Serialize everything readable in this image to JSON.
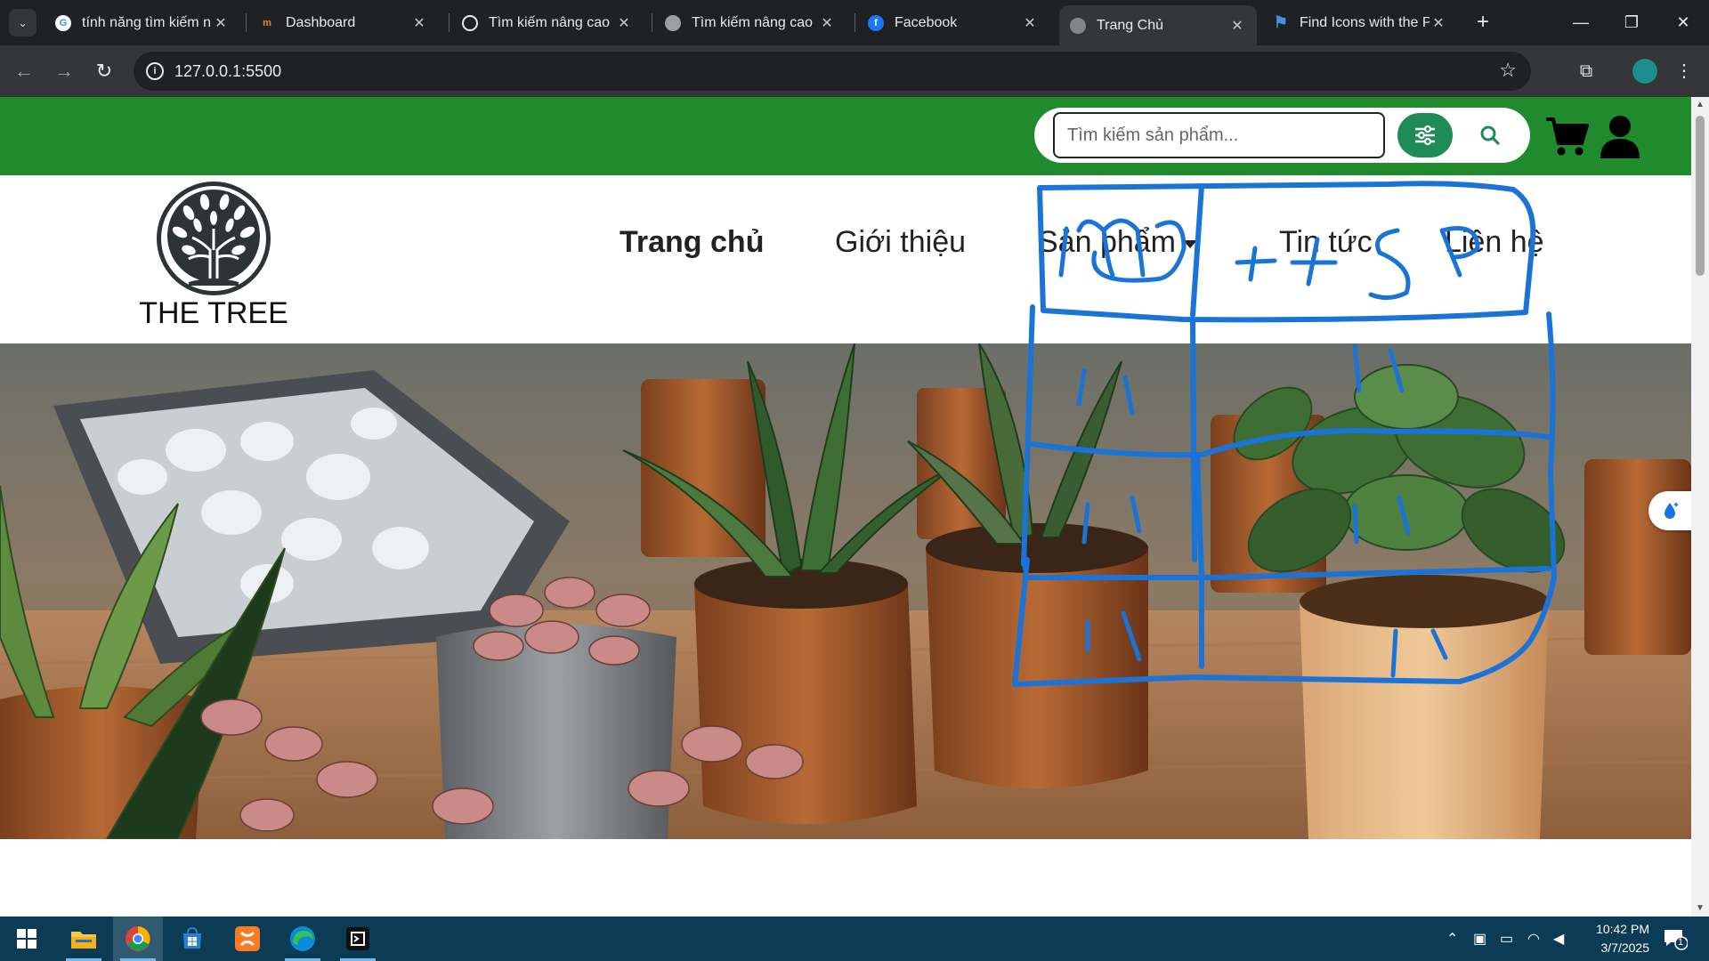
{
  "browser": {
    "tabs": [
      {
        "title": "tính năng tìm kiếm n",
        "icon": "google-icon",
        "active": false
      },
      {
        "title": "Dashboard",
        "icon": "dashboard-icon",
        "active": false
      },
      {
        "title": "Tìm kiếm nâng cao",
        "icon": "chatgpt-icon",
        "active": false
      },
      {
        "title": "Tìm kiếm nâng cao",
        "icon": "globe-icon",
        "active": false
      },
      {
        "title": "Facebook",
        "icon": "facebook-icon",
        "active": false
      },
      {
        "title": "Trang Chủ",
        "icon": "globe-icon",
        "active": true
      },
      {
        "title": "Find Icons with the P",
        "icon": "flag-icon",
        "active": false
      }
    ],
    "close_glyph": "✕",
    "new_tab_glyph": "+",
    "url": "127.0.0.1:5500"
  },
  "site": {
    "search": {
      "placeholder": "Tìm kiếm sản phẩm..."
    },
    "brand": "THE TREE",
    "nav": [
      {
        "label": "Trang chủ",
        "active": true
      },
      {
        "label": "Giới thiệu",
        "active": false
      },
      {
        "label": "Sản phẩm",
        "active": false,
        "has_dropdown": true
      },
      {
        "label": "Tin tức",
        "active": false
      },
      {
        "label": "Liên hệ",
        "active": false
      }
    ],
    "colors": {
      "header_green": "#1f8b2c",
      "filter_button": "#1f8b57",
      "annotation_blue": "#1a73d6"
    }
  },
  "annotation": {
    "scribble_text": "img + + SP"
  },
  "taskbar": {
    "apps": [
      "windows-start-icon",
      "file-explorer-icon",
      "chrome-icon",
      "microsoft-store-icon",
      "xampp-icon",
      "edge-icon",
      "terminal-icon"
    ],
    "time": "10:42 PM",
    "date": "3/7/2025",
    "notification_count": "1"
  }
}
